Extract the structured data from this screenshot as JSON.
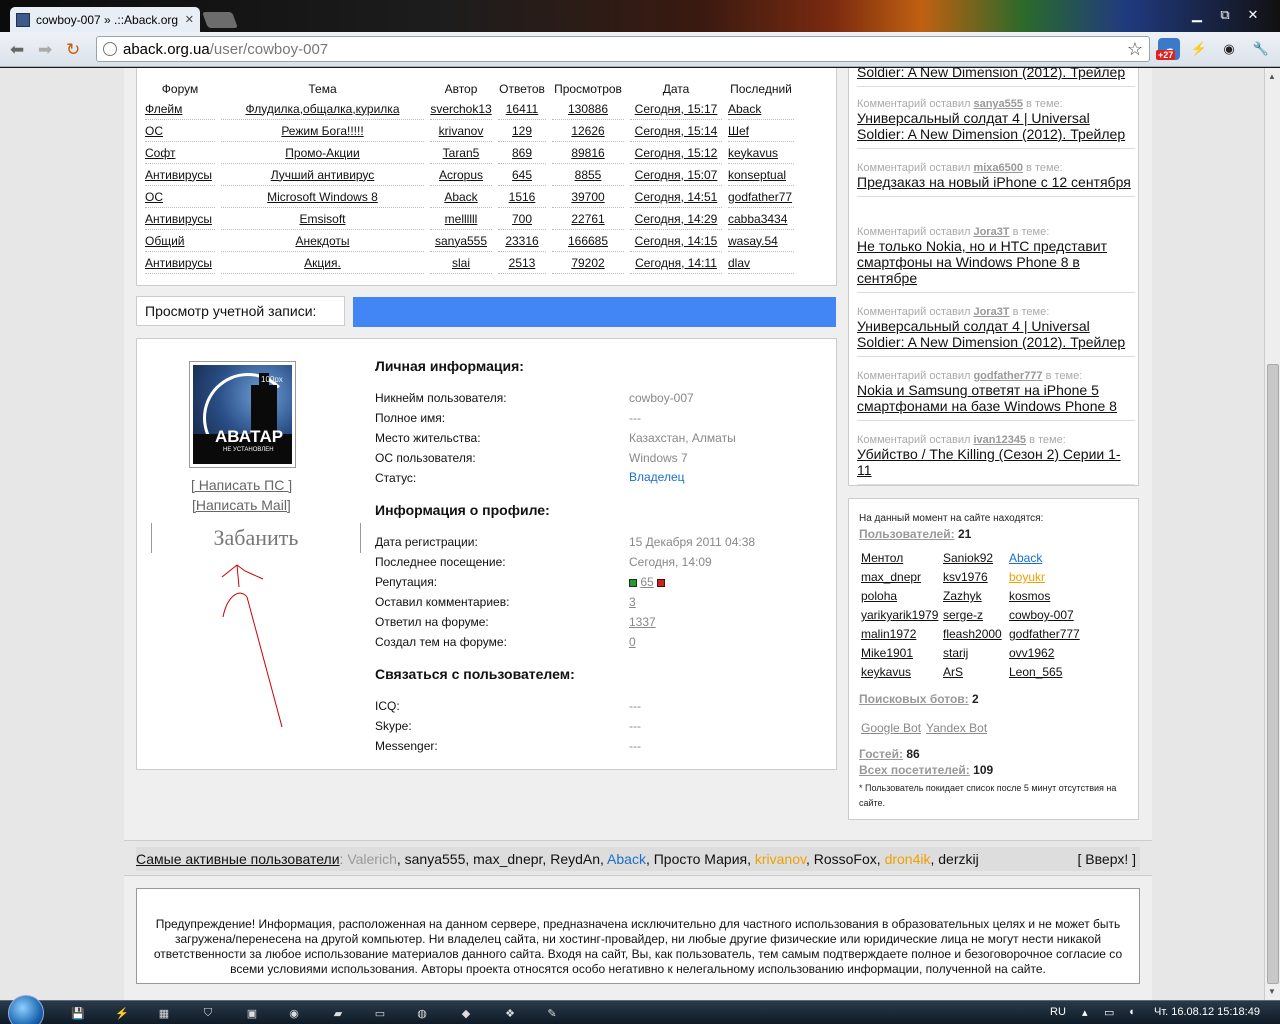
{
  "browser": {
    "tab_title": "cowboy-007 » .::Aback.org",
    "tab_close": "✕",
    "url_host": "aback.org.ua",
    "url_path": "/user/cowboy-007",
    "badge": "+27",
    "win_min": "▁",
    "win_max": "⧉",
    "win_close": "✕"
  },
  "forum": {
    "headers": [
      "Форум",
      "Тема",
      "Автор",
      "Ответов",
      "Просмотров",
      "Дата",
      "Последний"
    ],
    "rows": [
      [
        "Флейм",
        "Флудилка,общалка,курилка",
        "sverchok13",
        "16411",
        "130886",
        "Сегодня, 15:17",
        "Aback"
      ],
      [
        "ОС",
        "Режим Бога!!!!!",
        "krivanov",
        "129",
        "12626",
        "Сегодня, 15:14",
        "Шеf"
      ],
      [
        "Софт",
        "Промо-Акции",
        "Taran5",
        "869",
        "89816",
        "Сегодня, 15:12",
        "keykavus"
      ],
      [
        "Антивирусы",
        "Лучший антивирус",
        "Acropus",
        "645",
        "8855",
        "Сегодня, 15:07",
        "konseptual"
      ],
      [
        "ОС",
        "Microsoft Windows 8",
        "Aback",
        "1516",
        "39700",
        "Сегодня, 14:51",
        "godfather77"
      ],
      [
        "Антивирусы",
        "Emsisoft",
        "mellllll",
        "700",
        "22761",
        "Сегодня, 14:29",
        "cabba3434"
      ],
      [
        "Общий",
        "Анекдоты",
        "sanya555",
        "23316",
        "166685",
        "Сегодня, 14:15",
        "wasay.54"
      ],
      [
        "Антивирусы",
        "Акция.",
        "slai",
        "2513",
        "79202",
        "Сегодня, 14:11",
        "dlav"
      ]
    ]
  },
  "account": {
    "view_label": "Просмотр учетной записи:",
    "write_pm": "[ Написать ПС ]",
    "write_mail": "[Написать Mail]",
    "ban": "Забанить",
    "avatar_main": "АВАТАР",
    "avatar_sub": "НЕ УСТАНОВЛЕН",
    "avatar_size": "100px"
  },
  "personal": {
    "heading": "Личная информация:",
    "nick_label": "Никнейм пользователя:",
    "nick": "cowboy-007",
    "name_label": "Полное имя:",
    "name": "---",
    "city_label": "Место жительства:",
    "city": "Казахстан, Алматы",
    "os_label": "ОС пользователя:",
    "os": "Windows 7",
    "status_label": "Статус:",
    "status": "Владелец"
  },
  "profile": {
    "heading": "Информация о профиле:",
    "reg_label": "Дата регистрации:",
    "reg": "15 Декабря 2011 04:38",
    "last_label": "Последнее посещение:",
    "last": "Сегодня, 14:09",
    "rep_label": "Репутация:",
    "rep": "65",
    "comments_label": "Оставил комментариев:",
    "comments": "3",
    "replies_label": "Ответил на форуме:",
    "replies": "1337",
    "topics_label": "Создал тем на форуме:",
    "topics": "0"
  },
  "contact": {
    "heading": "Связаться с пользователем:",
    "icq_label": "ICQ:",
    "icq": "---",
    "skype_label": "Skype:",
    "skype": "---",
    "messenger_label": "Messenger:",
    "messenger": "---"
  },
  "comments": [
    {
      "meta": "",
      "user": "",
      "suffix": "",
      "title": "Soldier: A New Dimension (2012). Трейлер"
    },
    {
      "meta": "Комментарий оставил ",
      "user": "sanya555",
      "suffix": " в теме:",
      "title": "Универсальный солдат 4 | Universal Soldier: A New Dimension (2012). Трейлер"
    },
    {
      "meta": "Комментарий оставил ",
      "user": "mixa6500",
      "suffix": " в теме:",
      "title": "Предзаказ на новый iPhone с 12 сентября"
    },
    {
      "meta": "Комментарий оставил ",
      "user": "Jora3T",
      "suffix": " в теме:",
      "title": "Не только Nokia, но и HTC представит смартфоны на Windows Phone 8 в сентябре"
    },
    {
      "meta": "Комментарий оставил ",
      "user": "Jora3T",
      "suffix": " в теме:",
      "title": "Универсальный солдат 4 | Universal Soldier: A New Dimension (2012). Трейлер"
    },
    {
      "meta": "Комментарий оставил ",
      "user": "godfather777",
      "suffix": " в теме:",
      "title": "Nokia и Samsung ответят на iPhone 5 смартфонами на базе Windows Phone 8"
    },
    {
      "meta": "Комментарий оставил ",
      "user": "ivan12345",
      "suffix": " в теме:",
      "title": "Убийство / The Killing (Сезон 2) Серии 1-11"
    }
  ],
  "online": {
    "title": "На данный момент на сайте находятся:",
    "users_label": "Пользователей:",
    "users_count": "21",
    "users": [
      [
        "Ментол",
        "Saniok92",
        "Aback"
      ],
      [
        "max_dnepr",
        "ksv1976",
        "boyukr"
      ],
      [
        "poloha",
        "Zazhyk",
        "kosmos"
      ],
      [
        "yarikyarik1979",
        "serge-z",
        "cowboy-007"
      ],
      [
        "malin1972",
        "fleash2000",
        "godfather777"
      ],
      [
        "Mike1901",
        "starij",
        "ovv1962"
      ],
      [
        "keykavus",
        "ArS",
        "Leon_565"
      ]
    ],
    "bots_label": "Поисковых ботов:",
    "bots_count": "2",
    "bot1": "Google Bot",
    "bot2": "Yandex Bot",
    "guests_label": "Гостей:",
    "guests_count": "86",
    "total_label": "Всех посетителей:",
    "total_count": "109",
    "note": "* Пользователь покидает список после 5 минут отсутствия на сайте."
  },
  "active": {
    "label": "Самые активные пользователи",
    "sep": ":",
    "users": [
      {
        "name": "Valerich",
        "color": "#999999"
      },
      {
        "name": "sanya555",
        "color": "#111111"
      },
      {
        "name": "max_dnepr",
        "color": "#111111"
      },
      {
        "name": "ReydAn",
        "color": "#111111"
      },
      {
        "name": "Aback",
        "color": "#1a6fc8"
      },
      {
        "name": "Просто Мария",
        "color": "#111111"
      },
      {
        "name": "krivanov",
        "color": "#f0a000"
      },
      {
        "name": "RossoFox",
        "color": "#111111"
      },
      {
        "name": "dron4ik",
        "color": "#f0a000"
      },
      {
        "name": "derzkij",
        "color": "#111111"
      }
    ],
    "top_link": "[ Вверх! ]"
  },
  "footer_text": "Предупреждение! Информация, расположенная на данном сервере, предназначена исключительно для частного использования в образовательных целях и не может быть загружена/перенесена на другой компьютер. Ни владелец сайта, ни хостинг-провайдер, ни любые другие физические или юридические лица не могут нести никакой ответственности за любое использование материалов данного сайта. Входя на сайт, Вы, как пользователь, тем самым подтверждаете полное и безоговорочное согласие со всеми условиями использования. Авторы проекта относятся особо негативно к нелегальному использованию информации, полученной на сайте.",
  "taskbar": {
    "lang": "RU",
    "clock": "Чт. 16.08.12 15:18:49"
  }
}
